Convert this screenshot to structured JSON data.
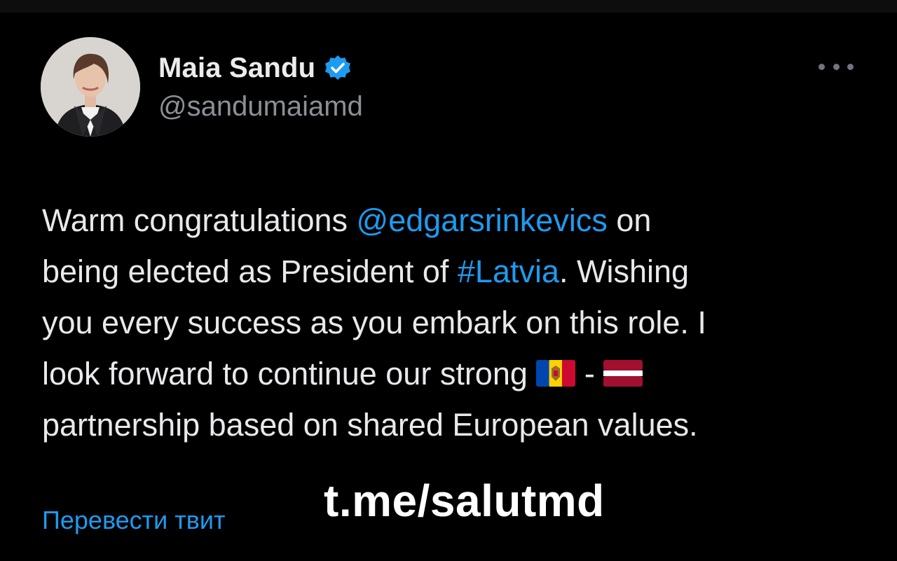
{
  "author": {
    "name": "Maia Sandu",
    "handle": "@sandumaiamd",
    "verified": true,
    "verified_color": "#1d9bf0"
  },
  "tweet": {
    "line1": {
      "t1": "Warm congratulations ",
      "mention": "@edgarsrinkevics",
      "t2": " on"
    },
    "line2": {
      "t1": "being elected as President of ",
      "hashtag": "#Latvia",
      "t2": ". Wishing"
    },
    "line3": "you every success as you embark on this role. I",
    "line4": {
      "t1": "look forward to continue our strong ",
      "flag1": "moldova-flag",
      "sep": " - ",
      "flag2": "latvia-flag"
    },
    "line5": "partnership based on shared European values."
  },
  "translate_label": "Перевести твит",
  "watermark": "t.me/salutmd",
  "colors": {
    "background": "#000000",
    "text": "#e7e9ea",
    "link": "#1d9bf0",
    "secondary": "#8b9096"
  },
  "icons": {
    "more": "more-dots-icon",
    "verified": "verified-badge-icon"
  }
}
